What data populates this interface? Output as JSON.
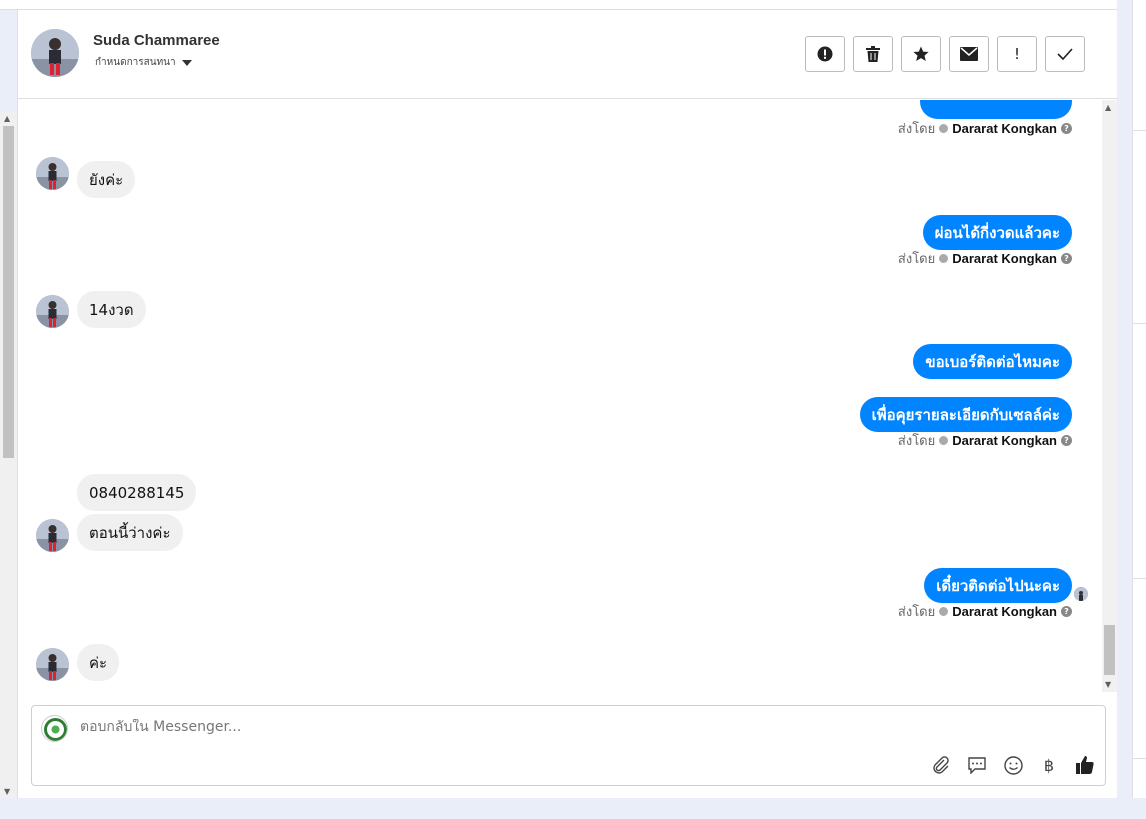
{
  "contact": {
    "name": "Suda Chammaree",
    "assign_label": "กำหนดการสนทนา"
  },
  "toolbar": {
    "spam_label": "!",
    "icons": [
      "alert-circle-icon",
      "trash-icon",
      "star-icon",
      "envelope-icon",
      "exclamation-icon",
      "check-icon"
    ]
  },
  "messages": [
    {
      "dir": "out",
      "text": ""
    },
    {
      "dir": "meta",
      "prefix": "ส่งโดย",
      "sender": "Dararat Kongkan"
    },
    {
      "dir": "in",
      "text": "ยังค่ะ"
    },
    {
      "dir": "out",
      "text": "ผ่อนได้กี่งวดแล้วคะ"
    },
    {
      "dir": "meta",
      "prefix": "ส่งโดย",
      "sender": "Dararat Kongkan"
    },
    {
      "dir": "in",
      "text": "14งวด"
    },
    {
      "dir": "out",
      "text": "ขอเบอร์ติดต่อไหมคะ"
    },
    {
      "dir": "out",
      "text": "เพื่อคุยรายละเอียดกับเซลล์ค่ะ"
    },
    {
      "dir": "meta",
      "prefix": "ส่งโดย",
      "sender": "Dararat Kongkan"
    },
    {
      "dir": "in",
      "text": "0840288145"
    },
    {
      "dir": "in",
      "text": "ตอนนี้ว่างค่ะ"
    },
    {
      "dir": "out",
      "text": "เดี๋ยวติดต่อไปนะคะ"
    },
    {
      "dir": "meta",
      "prefix": "ส่งโดย",
      "sender": "Dararat Kongkan"
    },
    {
      "dir": "in",
      "text": "ค่ะ"
    }
  ],
  "composer": {
    "placeholder": "ตอบกลับใน Messenger...",
    "currency_symbol": "฿",
    "tools": [
      "paperclip-icon",
      "saved-reply-icon",
      "emoji-icon",
      "baht-icon",
      "thumbs-up-icon"
    ]
  },
  "colors": {
    "accent": "#0084ff",
    "incoming_bubble": "#f0f0f0"
  }
}
